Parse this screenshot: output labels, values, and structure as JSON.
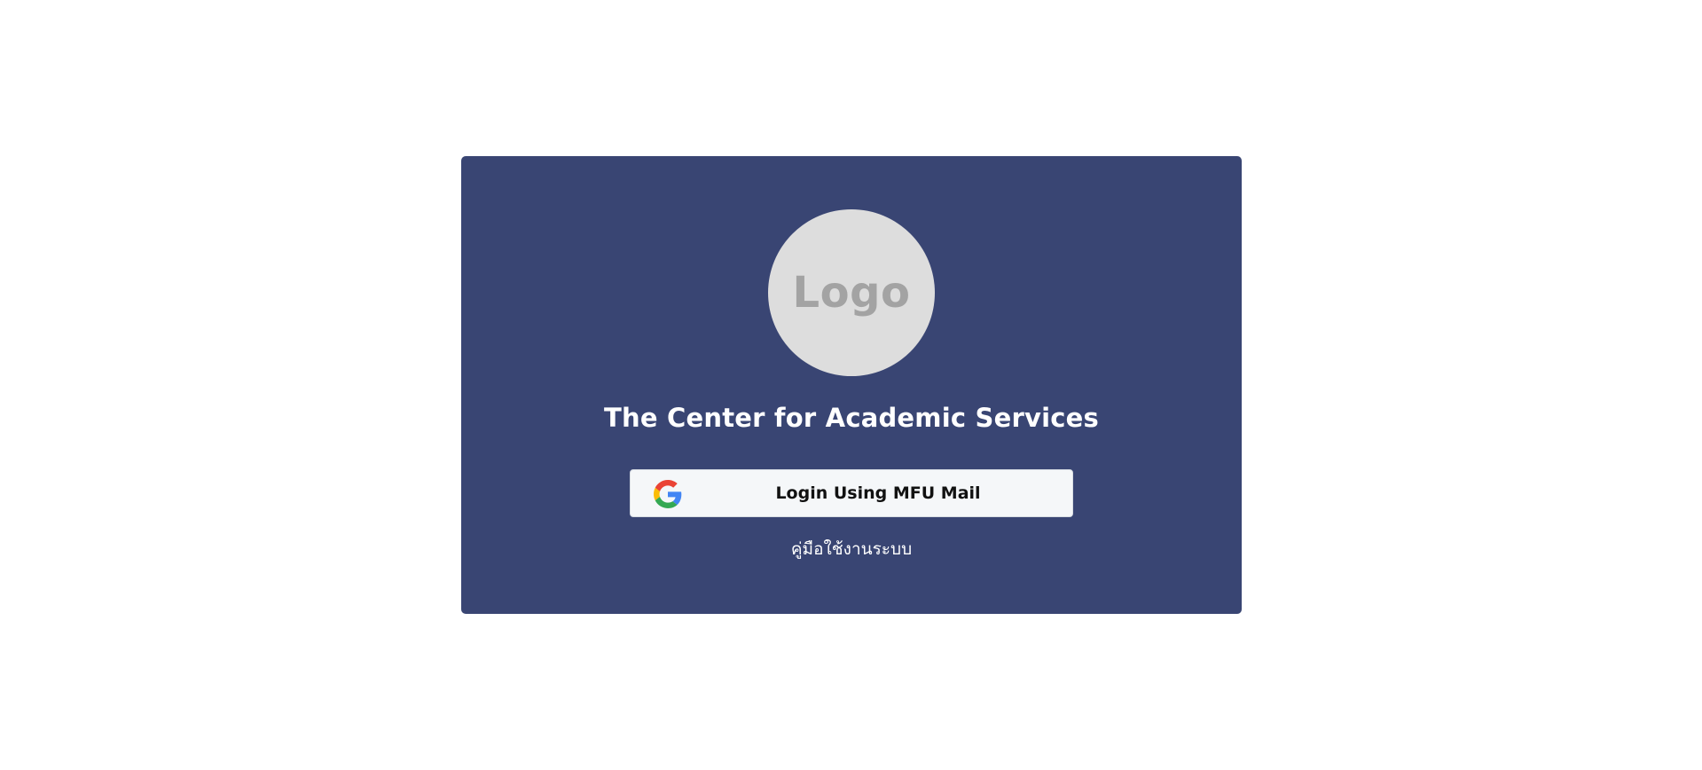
{
  "card": {
    "background_color": "#394573",
    "logo_text": "Logo",
    "title": "The Center for Academic Services",
    "login_button": {
      "label": "Login Using MFU Mail",
      "icon": "google-icon"
    },
    "manual_link": "คู่มือใช้งานระบบ"
  }
}
